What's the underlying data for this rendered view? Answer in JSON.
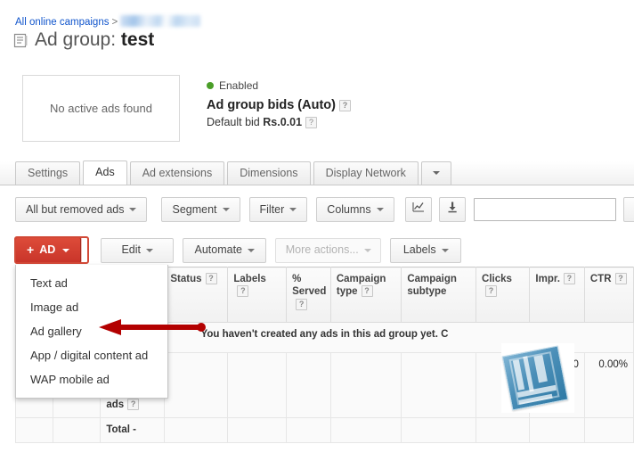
{
  "breadcrumb": {
    "root_label": "All online campaigns",
    "separator": ">",
    "redacted_label": ""
  },
  "header": {
    "title_prefix": "Ad group:",
    "title_name": "test",
    "icon": "ad-group-icon"
  },
  "summary": {
    "no_ads_text": "No active ads found",
    "status_label": "Enabled",
    "status_color": "#4a9e28",
    "bids_title": "Ad group bids (Auto)",
    "bids_help": "?",
    "default_bid_label": "Default bid",
    "default_bid_value": "Rs.0.01",
    "default_bid_help": "?"
  },
  "tabs": [
    {
      "label": "Settings",
      "active": false
    },
    {
      "label": "Ads",
      "active": true
    },
    {
      "label": "Ad extensions",
      "active": false
    },
    {
      "label": "Dimensions",
      "active": false
    },
    {
      "label": "Display Network",
      "active": false
    }
  ],
  "tabs_overflow_icon": "chevron-down-icon",
  "toolbar": {
    "filter_select_label": "All but removed ads",
    "segment_label": "Segment",
    "filter_label": "Filter",
    "columns_label": "Columns",
    "chart_icon": "line-chart-icon",
    "download_icon": "download-icon",
    "search_value": "",
    "search_placeholder": ""
  },
  "actionbar": {
    "ad_button_label": "AD",
    "ad_button_plus": "+",
    "ad_button_color": "#dd4b39",
    "edit_label": "Edit",
    "automate_label": "Automate",
    "more_actions_label": "More actions...",
    "more_actions_disabled": true,
    "labels_label": "Labels"
  },
  "ad_menu": {
    "items": [
      {
        "label": "Text ad"
      },
      {
        "label": "Image ad"
      },
      {
        "label": "Ad gallery"
      },
      {
        "label": "App / digital content ad"
      },
      {
        "label": "WAP mobile ad"
      }
    ]
  },
  "annotation": {
    "shape": "left-arrow",
    "color": "#b30000",
    "points_to": "Ad gallery"
  },
  "table": {
    "headers": [
      {
        "label": "",
        "help": false
      },
      {
        "label": "",
        "help": false
      },
      {
        "label": "",
        "help": false
      },
      {
        "label": "Status",
        "help": true
      },
      {
        "label": "Labels",
        "help": true
      },
      {
        "label": "% Served",
        "help": true
      },
      {
        "label": "Campaign type",
        "help": true
      },
      {
        "label": "Campaign subtype",
        "help": false
      },
      {
        "label": "Clicks",
        "help": true
      },
      {
        "label": "Impr.",
        "help": true
      },
      {
        "label": "CTR",
        "help": true
      }
    ],
    "empty_message": "You haven't created any ads in this ad group yet. C",
    "rows": [
      {
        "label": "Total - all but removed ads",
        "help": true,
        "status": "",
        "labels": "",
        "served": "",
        "campaign_type": "",
        "campaign_subtype": "",
        "clicks": "",
        "impressions": "0",
        "ctr": "0.00%"
      },
      {
        "label": "Total -",
        "help": false,
        "status": "",
        "labels": "",
        "served": "",
        "campaign_type": "",
        "campaign_subtype": "",
        "clicks": "",
        "impressions": "",
        "ctr": ""
      }
    ]
  },
  "empty_state_icon": "ad-gallery-asset-icon"
}
